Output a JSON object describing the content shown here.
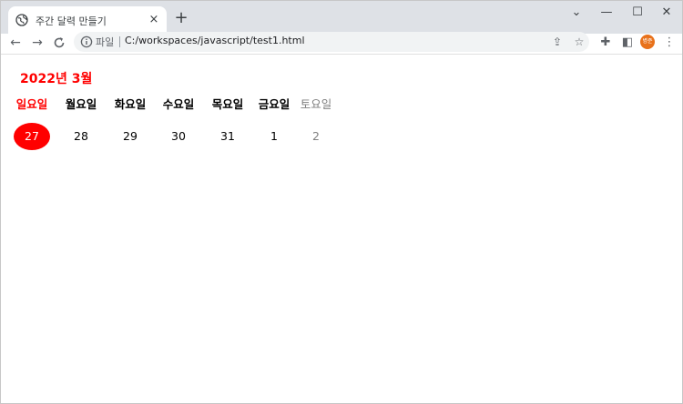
{
  "tab": {
    "title": "주간 달력 만들기",
    "close_icon": "×",
    "new_tab_icon": "+"
  },
  "window_controls": {
    "dropdown": "⌄",
    "minimize": "—",
    "maximize": "☐",
    "close": "✕"
  },
  "nav": {
    "back": "←",
    "forward": "→",
    "reload": "C"
  },
  "address": {
    "file_label": "파일",
    "url": "C:/workspaces/javascript/test1.html"
  },
  "toolbar_icons": {
    "share": "⇪",
    "bookmark": "☆",
    "extensions": "✚",
    "sidepanel": "◧",
    "menu": "⋮"
  },
  "profile": {
    "label": "병준"
  },
  "calendar": {
    "title": "2022년 3월",
    "headers": [
      "일요일",
      "월요일",
      "화요일",
      "수요일",
      "목요일",
      "금요일",
      "토요일"
    ],
    "dates": [
      "27",
      "28",
      "29",
      "30",
      "31",
      "1",
      "2"
    ],
    "colors": {
      "sunday": "#ff0000",
      "saturday": "#808080",
      "today_bg": "#ff0000",
      "today_text": "#ffffff"
    }
  }
}
